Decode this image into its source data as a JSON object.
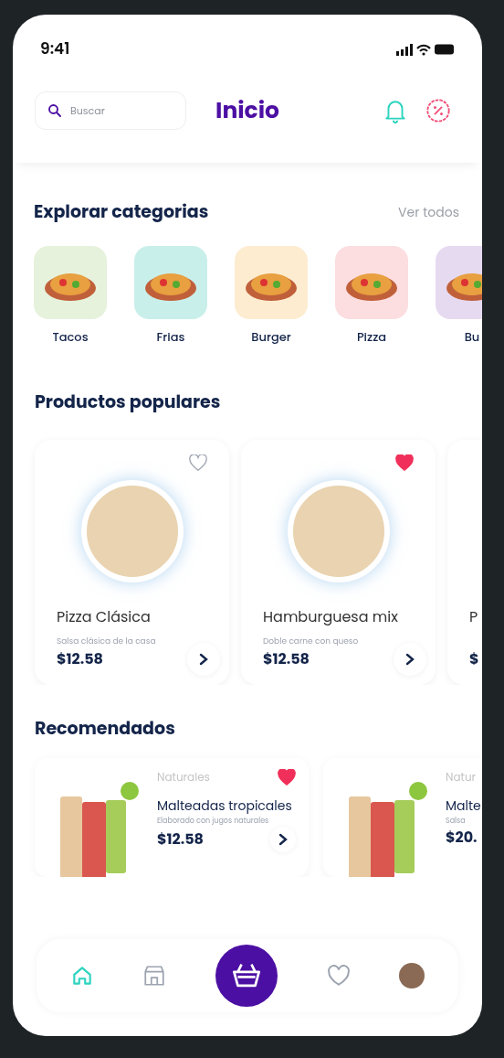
{
  "status_bar": {
    "time": "9:41"
  },
  "header": {
    "search": {
      "placeholder": "Buscar"
    },
    "title": "Inicio"
  },
  "categories": {
    "title": "Explorar categorias",
    "see_all": "Ver todos",
    "items": [
      {
        "label": "Tacos",
        "color": "#e6f2dc"
      },
      {
        "label": "Frias",
        "color": "#c9efea"
      },
      {
        "label": "Burger",
        "color": "#fdecd0"
      },
      {
        "label": "Pizza",
        "color": "#fcdde0"
      },
      {
        "label": "Bu",
        "color": "#e6daf0"
      }
    ]
  },
  "popular": {
    "title": "Productos populares",
    "items": [
      {
        "name": "Pizza Clásica",
        "description": "Salsa clásica de la casa",
        "price": "$12.58",
        "favorite": false
      },
      {
        "name": "Hamburguesa mix",
        "description": "Doble carne con queso",
        "price": "$12.58",
        "favorite": true
      },
      {
        "name": "P",
        "price": "$"
      }
    ]
  },
  "recommended": {
    "title": "Recomendados",
    "items": [
      {
        "category": "Naturales",
        "name": "Malteadas tropicales",
        "description": "Elaborado con jugos naturales",
        "price": "$12.58",
        "favorite": true
      },
      {
        "category": "Natur",
        "name": "Malte",
        "description": "Salsa",
        "price": "$20."
      }
    ]
  },
  "bottom_nav": [
    {
      "kind": "home",
      "selected": true
    },
    {
      "kind": "store",
      "selected": false
    },
    {
      "kind": "basket",
      "selected": false
    },
    {
      "kind": "heart",
      "selected": false
    },
    {
      "kind": "avatar",
      "selected": false
    }
  ]
}
